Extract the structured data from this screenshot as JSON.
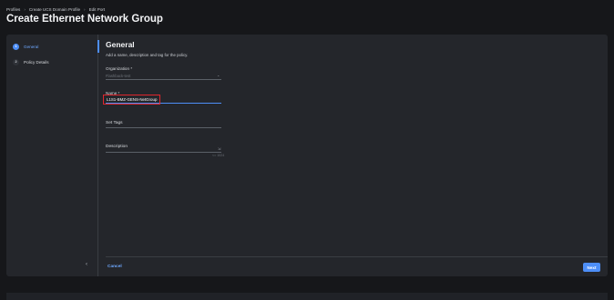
{
  "breadcrumb": {
    "items": [
      "Profiles",
      "Create UCS Domain Profile",
      "Edit Port"
    ],
    "separator": "›"
  },
  "page": {
    "title": "Create Ethernet Network Group"
  },
  "wizard": {
    "steps": [
      {
        "number": "1",
        "label": "General",
        "active": true
      },
      {
        "number": "2",
        "label": "Policy Details",
        "active": false
      }
    ],
    "collapse_icon": "chevron-left-icon"
  },
  "form": {
    "section_title": "General",
    "section_description": "Add a name, description and tag for the policy.",
    "organization": {
      "label": "Organization *",
      "value": "Flashback-test"
    },
    "name": {
      "label": "Name *",
      "value": "L1S1-BMZ-GENS-NetGroup"
    },
    "tags": {
      "label": "Set Tags"
    },
    "description": {
      "label": "Description",
      "counter": "<= 1024"
    }
  },
  "footer": {
    "cancel_label": "Cancel",
    "next_label": "Next"
  },
  "colors": {
    "accent": "#4d8ef7",
    "highlight_box": "#e0262d",
    "background": "#16171a",
    "card": "#24262b"
  }
}
